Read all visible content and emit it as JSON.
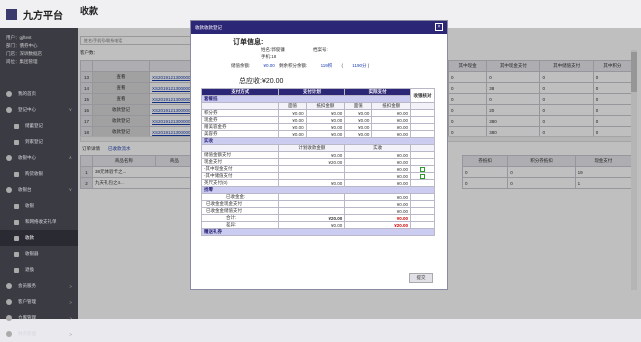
{
  "app": {
    "name": "九方平台",
    "page_title": "收款"
  },
  "user": {
    "line1": "用户：gjftest",
    "line2": "部门：債券中心",
    "line3": "门店：深圳数据店",
    "line4": "岗位：集团管理"
  },
  "nav": [
    {
      "label": "我的首页",
      "icon": "home-icon"
    },
    {
      "label": "登记中心",
      "icon": "circle-icon",
      "chev": "∨"
    },
    {
      "label": "储蓄登记",
      "icon": "dot-icon",
      "sub": true
    },
    {
      "label": "到家登记",
      "icon": "dot-icon",
      "sub": true
    },
    {
      "label": "收银中心",
      "icon": "star-icon",
      "chev": "∧"
    },
    {
      "label": "购货收银",
      "icon": "doc-icon",
      "sub": true
    },
    {
      "label": "收银台",
      "icon": "doc-icon",
      "chev": "∨"
    },
    {
      "label": "收银",
      "icon": "doc-icon",
      "sub": true
    },
    {
      "label": "和网络收支礼单",
      "icon": "doc-icon",
      "sub": true
    },
    {
      "label": "收款",
      "icon": "doc-icon",
      "sub": true
    },
    {
      "label": "收银器",
      "icon": "doc-icon",
      "sub": true
    },
    {
      "label": "退換",
      "icon": "doc-icon",
      "sub": true
    },
    {
      "label": "会员服务",
      "icon": "circle-icon",
      "chev": ">"
    },
    {
      "label": "客户管理",
      "icon": "person-icon",
      "chev": ">"
    },
    {
      "label": "仓库管理",
      "icon": "box-icon",
      "chev": ">"
    },
    {
      "label": "财务管理",
      "icon": "doc-icon",
      "chev": ">"
    }
  ],
  "search": {
    "placeholder": "姓名/手机号/联系电话"
  },
  "customer_label": "客户数：",
  "main_table": {
    "header": "销售单号",
    "rows": [
      {
        "num": "13",
        "btn": "查看",
        "order": "XS2019121300000"
      },
      {
        "num": "14",
        "btn": "查看",
        "order": "XS2019121300000"
      },
      {
        "num": "15",
        "btn": "查看",
        "order": "XS2019121300000"
      },
      {
        "num": "16",
        "btn": "收款登记",
        "order": "XS2019121300000"
      },
      {
        "num": "17",
        "btn": "收款登记",
        "order": "XS2019121300000"
      },
      {
        "num": "18",
        "btn": "收款登记",
        "order": "XS2019121300000"
      }
    ],
    "right_headers": [
      "其中现金",
      "其中现金支付",
      "其中储值支付",
      "其中积分"
    ],
    "right_rows": [
      [
        "0",
        "0",
        "0",
        "0"
      ],
      [
        "0",
        "38",
        "0",
        "0"
      ],
      [
        "0",
        "0",
        "0",
        "0"
      ],
      [
        "0",
        "20",
        "0",
        "0"
      ],
      [
        "0",
        "380",
        "0",
        "0"
      ],
      [
        "0",
        "380",
        "0",
        "0"
      ]
    ]
  },
  "lower_tabs": [
    "订单详情",
    "已收款流水"
  ],
  "lower_table": {
    "headers": [
      "商品名称",
      "商品"
    ],
    "rows": [
      [
        "1",
        "38元体验卡之..."
      ],
      [
        "2",
        "九天礼包之4..."
      ]
    ],
    "right_headers": [
      "券抵扣",
      "积分券抵扣",
      "现金支付"
    ],
    "right_rows": [
      [
        "0",
        "0",
        "19"
      ],
      [
        "0",
        "0",
        "1"
      ]
    ]
  },
  "modal": {
    "header": "收款收款登记",
    "close": "×",
    "order_title": "订单信息:",
    "name_label": "姓名:",
    "name_value": "郭俊镰",
    "card_label": "档案号:",
    "phone_label": "手机:",
    "phone_value": "18",
    "balance_label": "储值余额:",
    "balance_value": "¥0.00",
    "points_label": "剩余积分余额:",
    "points_value": "119积",
    "coupon_value": "1190分",
    "paren_open": "(",
    "paren_close": ")",
    "due_label": "总应收:",
    "due_value": "¥20.00",
    "table_headers": [
      "支付方式",
      "支付计划",
      "实际支付",
      "收银核对"
    ],
    "section_coupon": "套餐抵",
    "sub_headers": [
      "面值",
      "抵扣金额",
      "面值",
      "抵扣金额"
    ],
    "coupon_rows": [
      {
        "label": "积分券",
        "v": [
          "¥0.00",
          "¥0.00",
          "¥0.00",
          "¥0.00"
        ]
      },
      {
        "label": "现金券",
        "v": [
          "¥0.00",
          "¥0.00",
          "¥0.00",
          "¥0.00"
        ]
      },
      {
        "label": "赠美容金券",
        "v": [
          "¥0.00",
          "¥0.00",
          "¥0.00",
          "¥0.00"
        ]
      },
      {
        "label": "美容券",
        "v": [
          "¥0.00",
          "¥0.00",
          "¥0.00",
          "¥0.00"
        ]
      }
    ],
    "section_actual": "实收",
    "plan_label": "计划收款金额",
    "actual_label": "实收",
    "pay_rows": [
      {
        "label": "储值金额支付",
        "plan": "¥0.00",
        "actual": "¥0.00"
      },
      {
        "label": "现金支付",
        "plan": "¥20.00",
        "actual": "¥0.00"
      },
      {
        "label": "-其中现金支付",
        "plan": "",
        "actual": "¥0.00"
      },
      {
        "label": "-其中储值支付",
        "plan": "",
        "actual": "¥0.00"
      },
      {
        "label": "英尺支付(0)",
        "plan": "¥0.00",
        "actual": "¥0.00"
      }
    ],
    "section_change": "找零",
    "change_rows": [
      {
        "label": "已收金金:",
        "plan": "",
        "actual": "¥0.00"
      },
      {
        "label": "已收金金现金支付",
        "plan": "",
        "actual": "¥0.00"
      },
      {
        "label": "已收金金储值支付",
        "plan": "",
        "actual": "¥0.00"
      },
      {
        "label": "合计:",
        "plan": "¥20.00",
        "actual": "¥0.00"
      },
      {
        "label": "差异:",
        "plan": "¥0.00",
        "actual": "¥20.00"
      }
    ],
    "section_gift": "赠送礼券",
    "submit": "提交"
  }
}
